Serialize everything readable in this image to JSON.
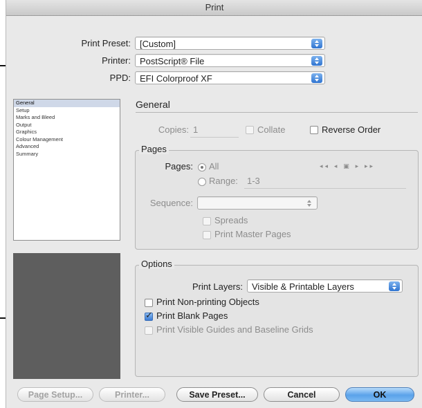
{
  "window": {
    "title": "Print"
  },
  "top": {
    "preset_label": "Print Preset:",
    "preset_value": "[Custom]",
    "printer_label": "Printer:",
    "printer_value": "PostScript® File",
    "ppd_label": "PPD:",
    "ppd_value": "EFI Colorproof XF"
  },
  "sidebar": {
    "items": [
      {
        "label": "General",
        "selected": true
      },
      {
        "label": "Setup"
      },
      {
        "label": "Marks and Bleed"
      },
      {
        "label": "Output"
      },
      {
        "label": "Graphics"
      },
      {
        "label": "Colour Management"
      },
      {
        "label": "Advanced"
      },
      {
        "label": "Summary"
      }
    ]
  },
  "general": {
    "title": "General",
    "copies_label": "Copies:",
    "copies_value": "1",
    "collate_label": "Collate",
    "reverse_label": "Reverse Order",
    "pages_group": "Pages",
    "pages_label": "Pages:",
    "all_label": "All",
    "range_label": "Range:",
    "range_value": "1-3",
    "page_nav": "◂◂ ◂ ▣ ▸ ▸▸",
    "sequence_label": "Sequence:",
    "spreads_label": "Spreads",
    "master_label": "Print Master Pages"
  },
  "options": {
    "title": "Options",
    "layers_label": "Print Layers:",
    "layers_value": "Visible & Printable Layers",
    "nonprinting_label": "Print Non-printing Objects",
    "blank_label": "Print Blank Pages",
    "blank_checked": true,
    "guides_label": "Print Visible Guides and Baseline Grids"
  },
  "buttons": {
    "page_setup": "Page Setup...",
    "printer": "Printer...",
    "save_preset": "Save Preset...",
    "cancel": "Cancel",
    "ok": "OK"
  }
}
